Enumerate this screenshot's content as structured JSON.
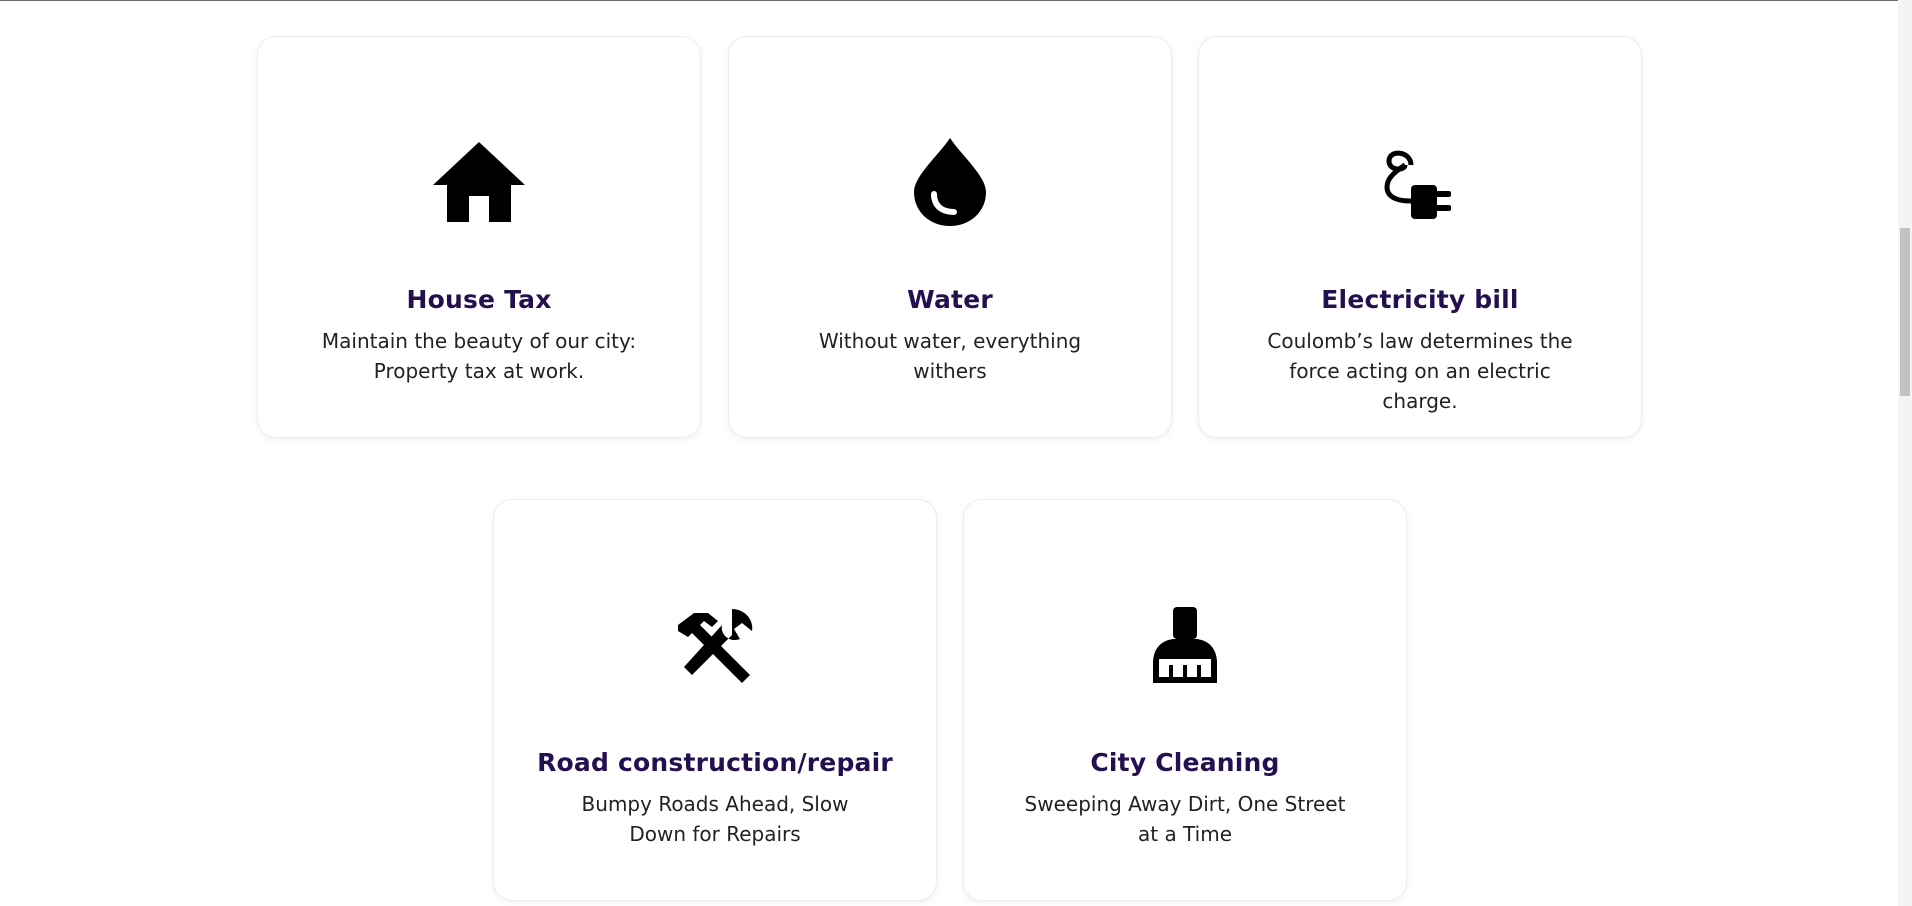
{
  "services": [
    {
      "icon": "house-icon",
      "title": "House Tax",
      "description": "Maintain the beauty of our city: Property tax at work."
    },
    {
      "icon": "water-drop-icon",
      "title": "Water",
      "description": "Without water, everything withers"
    },
    {
      "icon": "plug-icon",
      "title": "Electricity bill",
      "description": "Coulomb’s law determines the force acting on an electric charge."
    },
    {
      "icon": "hammer-wrench-icon",
      "title": "Road construction/repair",
      "description": "Bumpy Roads Ahead, Slow Down for Repairs"
    },
    {
      "icon": "broom-icon",
      "title": "City Cleaning",
      "description": "Sweeping Away Dirt, One Street at a Time"
    }
  ],
  "colors": {
    "title": "#24104f",
    "text": "#222222",
    "icon": "#000000"
  }
}
